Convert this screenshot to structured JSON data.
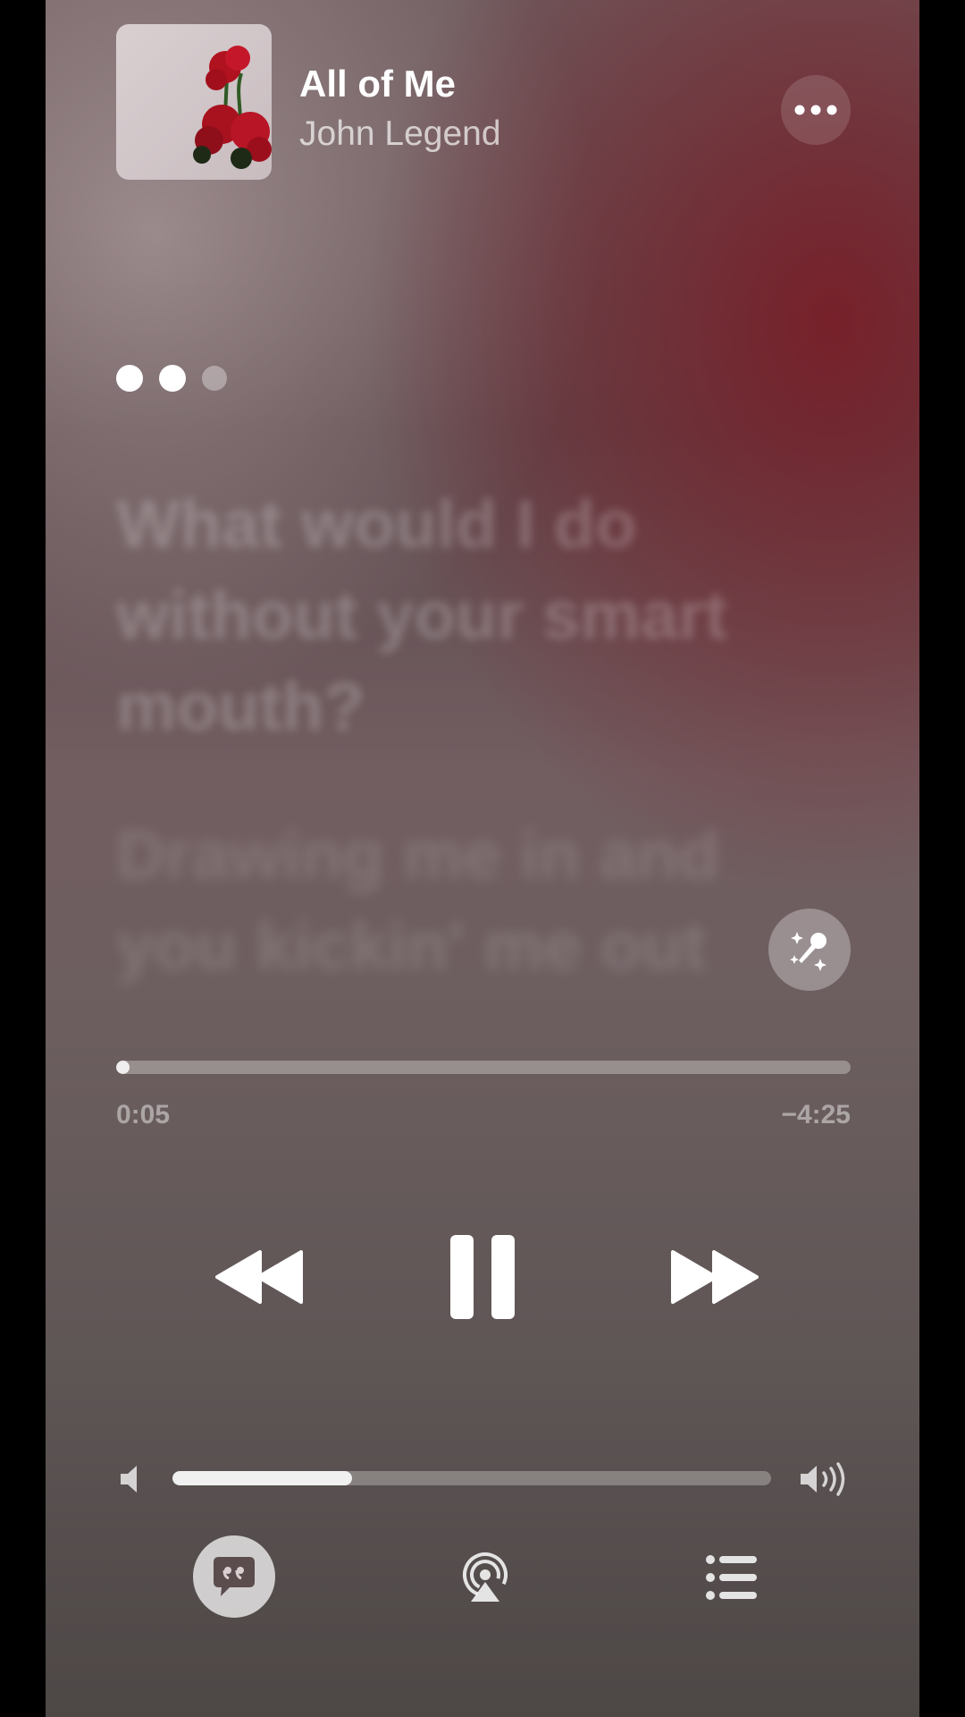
{
  "now_playing": {
    "title": "All of Me",
    "artist": "John Legend"
  },
  "pager": {
    "count": 3,
    "active_dots": 2
  },
  "lyrics": {
    "current": "What would I do without your smart mouth?",
    "next": "Drawing me in and you kickin' me out"
  },
  "progress": {
    "elapsed": "0:05",
    "remaining": "−4:25",
    "fraction": 0.018
  },
  "volume": {
    "fraction": 0.3
  },
  "icons": {
    "more": "ellipsis-icon",
    "sing": "microphone-sparkle-icon",
    "rewind": "backward-icon",
    "pause": "pause-icon",
    "forward": "forward-icon",
    "volume_low": "speaker-low-icon",
    "volume_high": "speaker-high-icon",
    "lyrics": "quote-bubble-icon",
    "airplay": "airplay-icon",
    "queue": "list-icon"
  },
  "colors": {
    "accent_red": "#7a1e28",
    "text_primary": "#ffffff"
  }
}
